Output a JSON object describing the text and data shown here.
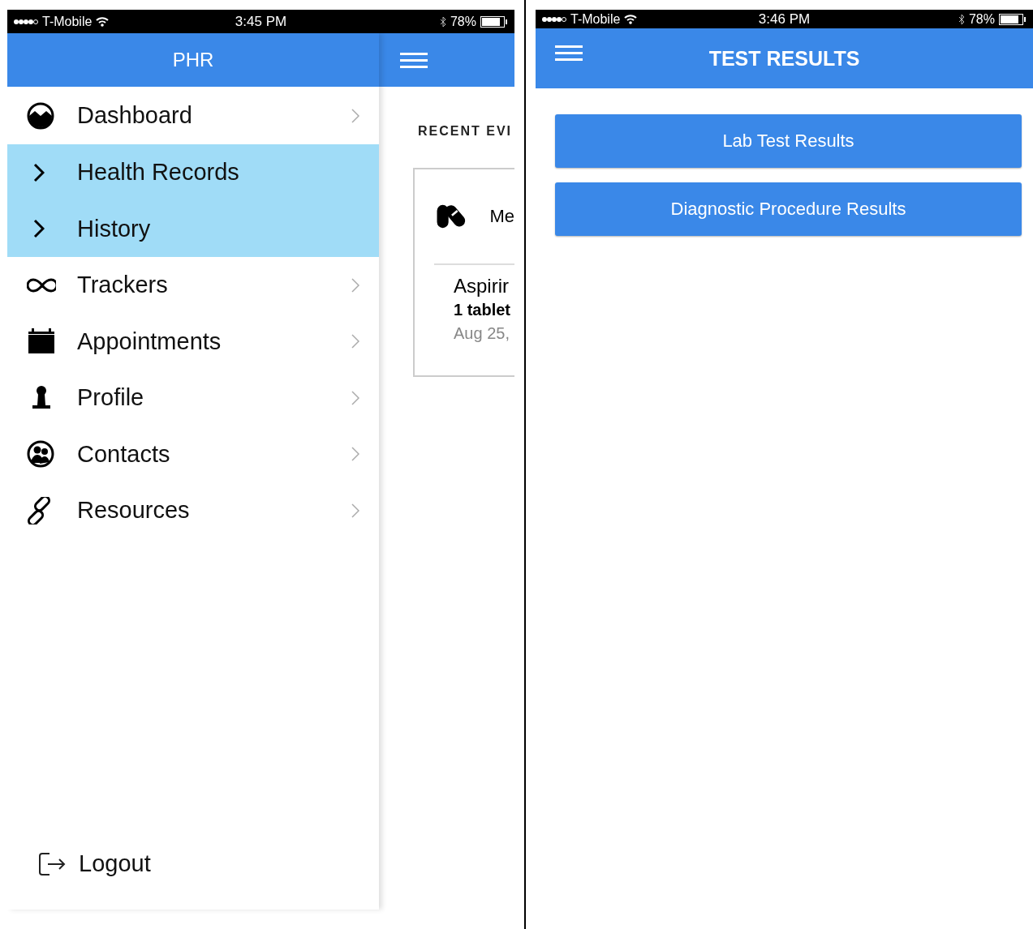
{
  "left_screen": {
    "status_bar": {
      "carrier": "T-Mobile",
      "time": "3:45 PM",
      "battery": "78%"
    },
    "header": {
      "title": "PHR"
    },
    "menu": {
      "items": [
        {
          "label": "Dashboard",
          "kind": "link",
          "selected": false
        },
        {
          "label": "Health Records",
          "kind": "group",
          "selected": true
        },
        {
          "label": "History",
          "kind": "group",
          "selected": true
        },
        {
          "label": "Trackers",
          "kind": "link",
          "selected": false
        },
        {
          "label": "Appointments",
          "kind": "link",
          "selected": false
        },
        {
          "label": "Profile",
          "kind": "link",
          "selected": false
        },
        {
          "label": "Contacts",
          "kind": "link",
          "selected": false
        },
        {
          "label": "Resources",
          "kind": "link",
          "selected": false
        }
      ],
      "logout": "Logout"
    },
    "content": {
      "section_title": "RECENT EVI",
      "card": {
        "title": "Me",
        "name": "Aspirir",
        "dose": "1 tablet",
        "date": "Aug 25,"
      }
    }
  },
  "right_screen": {
    "status_bar": {
      "carrier": "T-Mobile",
      "time": "3:46 PM",
      "battery": "78%"
    },
    "header": {
      "title": "TEST RESULTS"
    },
    "buttons": [
      "Lab Test Results",
      "Diagnostic Procedure Results"
    ]
  }
}
